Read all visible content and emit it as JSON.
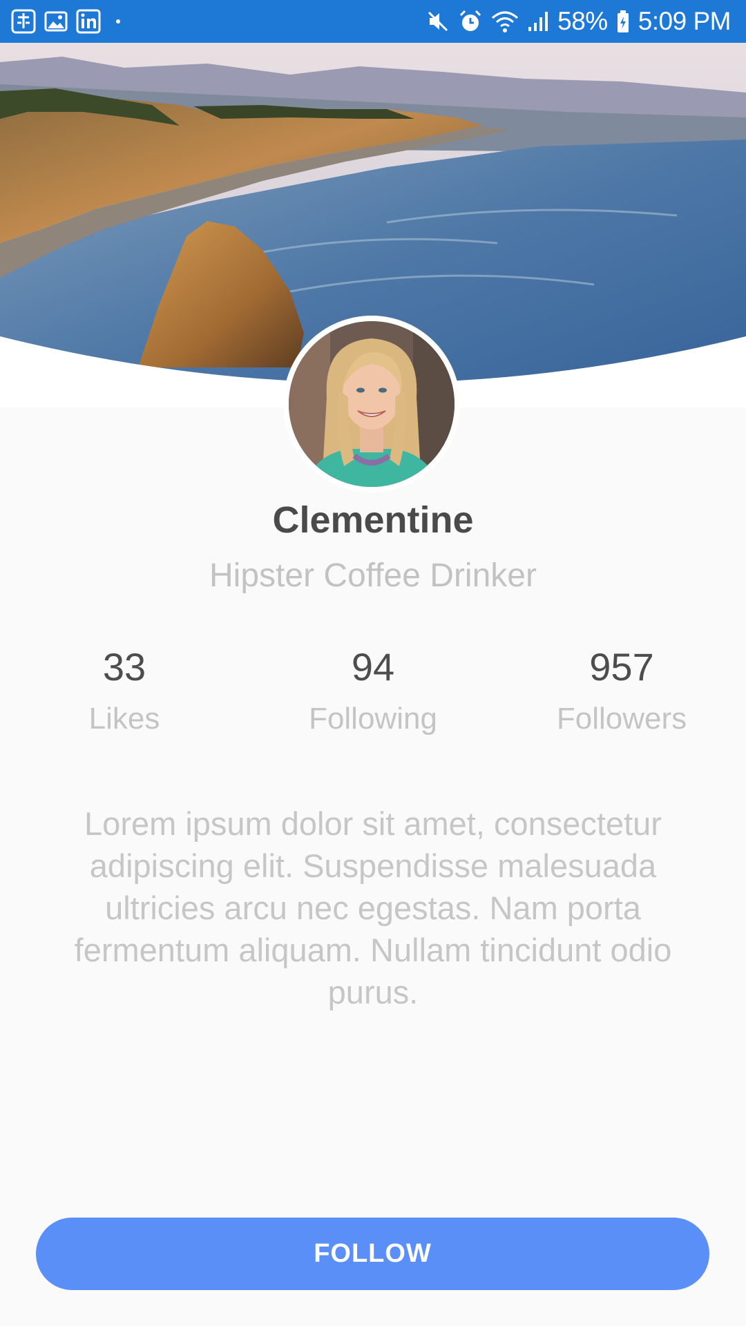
{
  "status_bar": {
    "battery": "58%",
    "time": "5:09 PM",
    "left_icons": [
      "tasks-icon",
      "gallery-icon",
      "linkedin-icon"
    ],
    "right_icons": [
      "mute-icon",
      "alarm-icon",
      "wifi-icon",
      "signal-icon",
      "battery-icon"
    ],
    "color": "#1e78d6"
  },
  "profile": {
    "name": "Clementine",
    "title": "Hipster Coffee Drinker"
  },
  "stats": [
    {
      "value": "33",
      "label": "Likes"
    },
    {
      "value": "94",
      "label": "Following"
    },
    {
      "value": "957",
      "label": "Followers"
    }
  ],
  "bio": "Lorem ipsum dolor sit amet, consectetur adipiscing elit. Suspendisse malesuada ultricies arcu nec egestas. Nam porta fermentum aliquam. Nullam tincidunt odio purus.",
  "follow_button": {
    "label": "FOLLOW",
    "color": "#5a8ff8"
  }
}
